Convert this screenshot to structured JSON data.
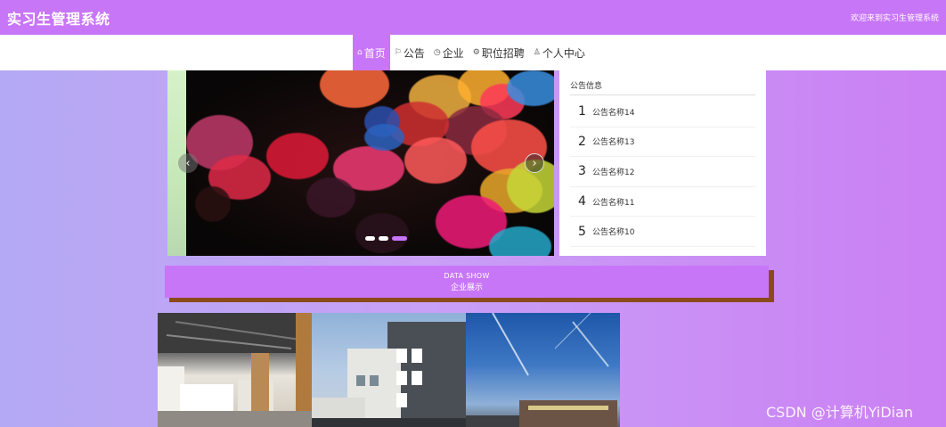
{
  "header": {
    "title": "实习生管理系统",
    "welcome": "欢迎来到实习生管理系统"
  },
  "nav": {
    "items": [
      {
        "label": "首页",
        "icon": "home-icon",
        "active": true
      },
      {
        "label": "公告",
        "icon": "flag-icon",
        "active": false
      },
      {
        "label": "企业",
        "icon": "clock-icon",
        "active": false
      },
      {
        "label": "职位招聘",
        "icon": "gear-icon",
        "active": false
      },
      {
        "label": "个人中心",
        "icon": "user-icon",
        "active": false
      }
    ]
  },
  "carousel": {
    "slide_count": 3,
    "active_index": 2,
    "prev_label": "‹",
    "next_label": "›"
  },
  "notice": {
    "title": "公告信息",
    "items": [
      {
        "num": "1",
        "name": "公告名称14"
      },
      {
        "num": "2",
        "name": "公告名称13"
      },
      {
        "num": "3",
        "name": "公告名称12"
      },
      {
        "num": "4",
        "name": "公告名称11"
      },
      {
        "num": "5",
        "name": "公告名称10"
      }
    ]
  },
  "data_show": {
    "en": "DATA SHOW",
    "cn": "企业展示"
  },
  "watermark": "CSDN @计算机YiDian",
  "colors": {
    "accent": "#c876f8",
    "banner_shadow": "#8b4a1a"
  }
}
